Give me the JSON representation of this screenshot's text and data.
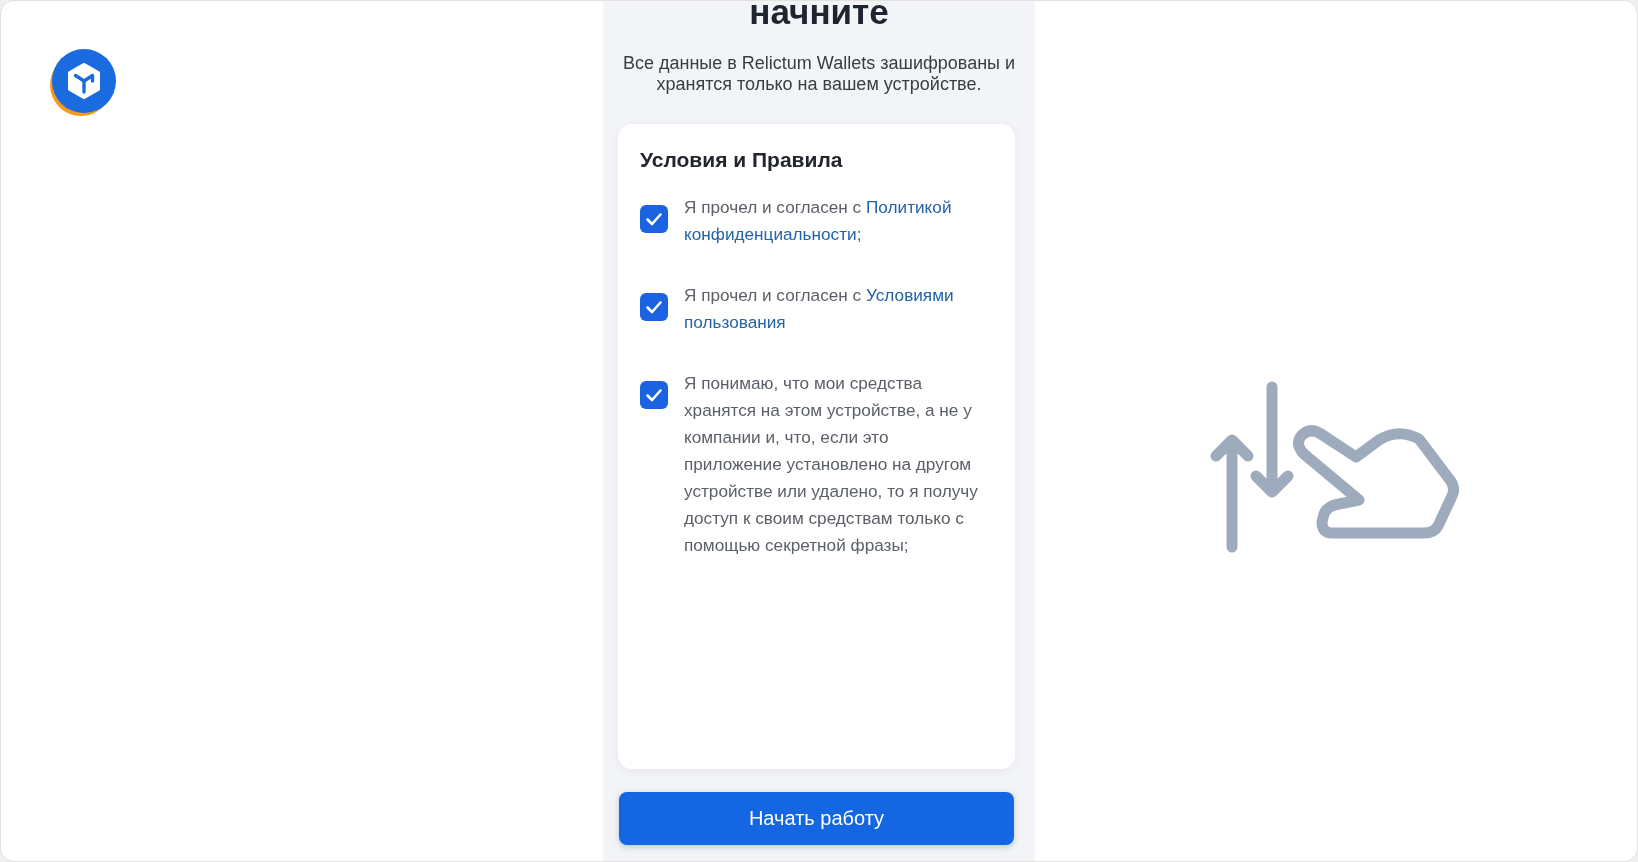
{
  "screen": {
    "heading": "начните",
    "subtitle": "Все данные в Relictum Wallets зашифрованы и хранятся только на вашем устройстве.",
    "terms_card": {
      "title": "Условия и Правила",
      "items": [
        {
          "text": "Я прочел и согласен с",
          "link": "Политикой конфиденциальности",
          "tail": ";",
          "checked": true
        },
        {
          "text": "Я прочел и согласен с",
          "link": "Условиями пользования",
          "checked": true
        },
        {
          "text": "Я понимаю, что мои средства хранятся на этом устройстве, а не у компании и, что, если это приложение установлено на другом устройстве или удалено, то я получу доступ к своим средствам только с помощью секретной фразы;",
          "checked": true
        }
      ]
    },
    "start_button": "Начать работу"
  }
}
